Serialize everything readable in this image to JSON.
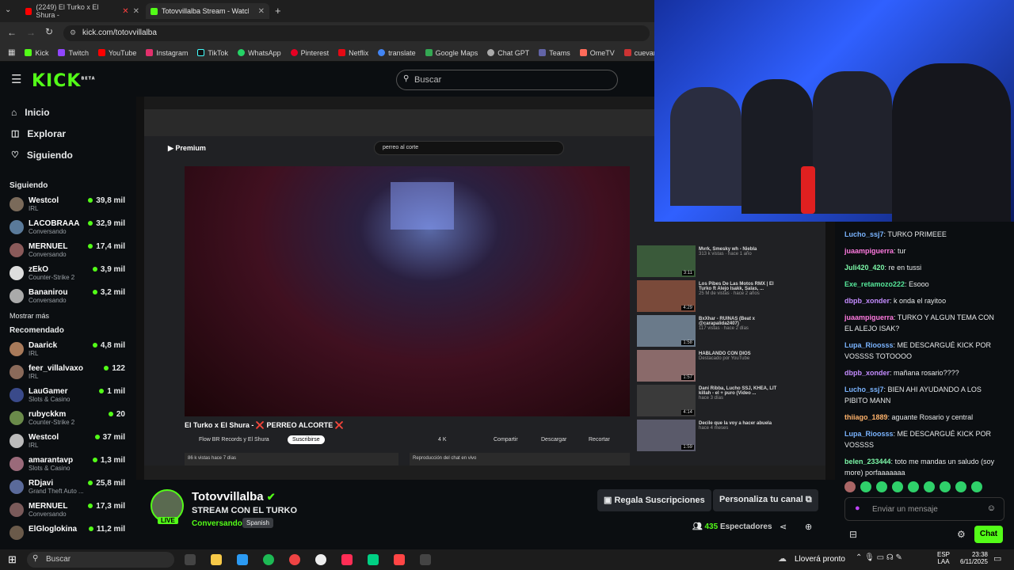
{
  "browser": {
    "tabs": [
      {
        "label": "(2249) El Turko x El Shura - ",
        "active": false
      },
      {
        "label": "Totovvillalba Stream - Watch Li",
        "active": true
      }
    ],
    "url": "kick.com/totovvillalba",
    "bookmarks": [
      "Kick",
      "Twitch",
      "YouTube",
      "Instagram",
      "TikTok",
      "WhatsApp",
      "Pinterest",
      "Netflix",
      "translate",
      "Google Maps",
      "Chat GPT",
      "Teams",
      "OmeTV",
      "cuevana"
    ]
  },
  "header": {
    "logo": "KICK",
    "logo_sup": "BETA",
    "search_placeholder": "Buscar"
  },
  "sidebar": {
    "nav": [
      {
        "label": "Inicio",
        "icon": "home-icon"
      },
      {
        "label": "Explorar",
        "icon": "compass-icon"
      },
      {
        "label": "Siguiendo",
        "icon": "heart-icon"
      }
    ],
    "following_title": "Siguiendo",
    "following": [
      {
        "name": "Westcol",
        "category": "IRL",
        "viewers": "39,8 mil"
      },
      {
        "name": "LACOBRAAA",
        "category": "Conversando",
        "viewers": "32,9 mil"
      },
      {
        "name": "MERNUEL",
        "category": "Conversando",
        "viewers": "17,4 mil"
      },
      {
        "name": "zEkO",
        "category": "Counter-Strike 2",
        "viewers": "3,9 mil"
      },
      {
        "name": "Bananirou",
        "category": "Conversando",
        "viewers": "3,2 mil"
      }
    ],
    "show_more": "Mostrar más",
    "recommended_title": "Recomendado",
    "recommended": [
      {
        "name": "Daarick",
        "category": "IRL",
        "viewers": "4,8 mil"
      },
      {
        "name": "feer_villalvaxo",
        "category": "IRL",
        "viewers": "122"
      },
      {
        "name": "LauGamer",
        "category": "Slots & Casino",
        "viewers": "1 mil"
      },
      {
        "name": "rubyckkm",
        "category": "Counter-Strike 2",
        "viewers": "20"
      },
      {
        "name": "Westcol",
        "category": "IRL",
        "viewers": "37 mil"
      },
      {
        "name": "amarantavp",
        "category": "Slots & Casino",
        "viewers": "1,3 mil"
      },
      {
        "name": "RDjavi",
        "category": "Grand Theft Auto ...",
        "viewers": "25,8 mil"
      },
      {
        "name": "MERNUEL",
        "category": "Conversando",
        "viewers": "17,3 mil"
      },
      {
        "name": "ElGloglokina",
        "category": "",
        "viewers": "11,2 mil"
      }
    ]
  },
  "video": {
    "yt_search": "perreo al corte",
    "yt_title": "El Turko x El Shura - ❌ PERREO ALCORTE ❌",
    "yt_channel": "Flow BR Records y El Shura",
    "yt_subscribe": "Suscribirse",
    "yt_likes": "4 K",
    "yt_share": "Compartir",
    "yt_download": "Descargar",
    "yt_clip": "Recortar",
    "yt_views": "86 k vistas hace 7 días",
    "yt_chat_replay": "Reproducción del chat en vivo",
    "related": [
      {
        "title": "Mvrk, Smesky wh - Niebla",
        "meta": "313 k vistas · hace 1 año",
        "duration": "3:11"
      },
      {
        "title": "Los Pibes De Las Motos RMX | El Turko ft Alejo Isakk, Salas, ...",
        "meta": "25 M de vistas · hace 2 años",
        "duration": "4:29"
      },
      {
        "title": "BxXhar - RUINAS (Beat x @carapalida2407)",
        "meta": "117 vistas · hace 2 días",
        "duration": "1:58"
      },
      {
        "title": "HABLANDO CON DIOS",
        "meta": "Destacado por YouTube",
        "duration": "1:57"
      },
      {
        "title": "Dani Ribba, Lucho SSJ, KHEA, LIT killah - el + puro (Video ...",
        "meta": "hace 3 días",
        "duration": "4:14"
      },
      {
        "title": "Decile que la voy a hacer abuela",
        "meta": "hace 4 meses",
        "duration": "1:59"
      }
    ]
  },
  "stream": {
    "channel": "Totovvillalba",
    "title": "STREAM CON EL TURKO",
    "category": "Conversando",
    "language": "Spanish",
    "live_label": "LIVE",
    "gift_button": "Regala Suscripciones",
    "customize_button": "Personaliza tu canal",
    "viewers": "435",
    "viewers_label": "Espectadores"
  },
  "chat": {
    "messages": [
      {
        "user": "Lucho_ssj7",
        "color": "#7ab4ff",
        "text": "TURKO PRIMEEE"
      },
      {
        "user": "juaampiguerra",
        "color": "#ff7ae0",
        "text": "tur"
      },
      {
        "user": "Juli420_420",
        "color": "#7cf7a8",
        "text": "re en tussi"
      },
      {
        "user": "Exe_retamozo222",
        "color": "#56e89a",
        "text": "Esooo"
      },
      {
        "user": "dbpb_xonder",
        "color": "#c48cff",
        "text": "k onda el rayitoo"
      },
      {
        "user": "juaampiguerra",
        "color": "#ff7ae0",
        "text": "TURKO Y ALGUN TEMA CON EL ALEJO ISAK?"
      },
      {
        "user": "Lupa_Rioosss",
        "color": "#7ab4ff",
        "text": "ME DESCARGUÉ KICK POR VOSSSS TOTOOOO"
      },
      {
        "user": "dbpb_xonder",
        "color": "#c48cff",
        "text": "mañana rosario????"
      },
      {
        "user": "Lucho_ssj7",
        "color": "#7ab4ff",
        "text": "BIEN AHI AYUDANDO A LOS PIBITO MANN"
      },
      {
        "user": "thiiago_1889",
        "color": "#ffb36b",
        "text": "aguante Rosario y central"
      },
      {
        "user": "Lupa_Rioosss",
        "color": "#7ab4ff",
        "text": "ME DESCARGUÉ KICK POR VOSSSS"
      },
      {
        "user": "belen_233444",
        "color": "#7cf7a8",
        "text": "toto me mandas un saludo (soy more) porfaaaaaaa"
      }
    ],
    "input_placeholder": "Enviar un mensaje",
    "send_button": "Chat"
  },
  "taskbar": {
    "search_placeholder": "Buscar",
    "weather": "Lloverá pronto",
    "lang": "ESP",
    "lang2": "LAA",
    "time": "23:38",
    "date": "6/11/2025"
  },
  "colors": {
    "accent": "#53fc18",
    "bg": "#0b0e11"
  }
}
